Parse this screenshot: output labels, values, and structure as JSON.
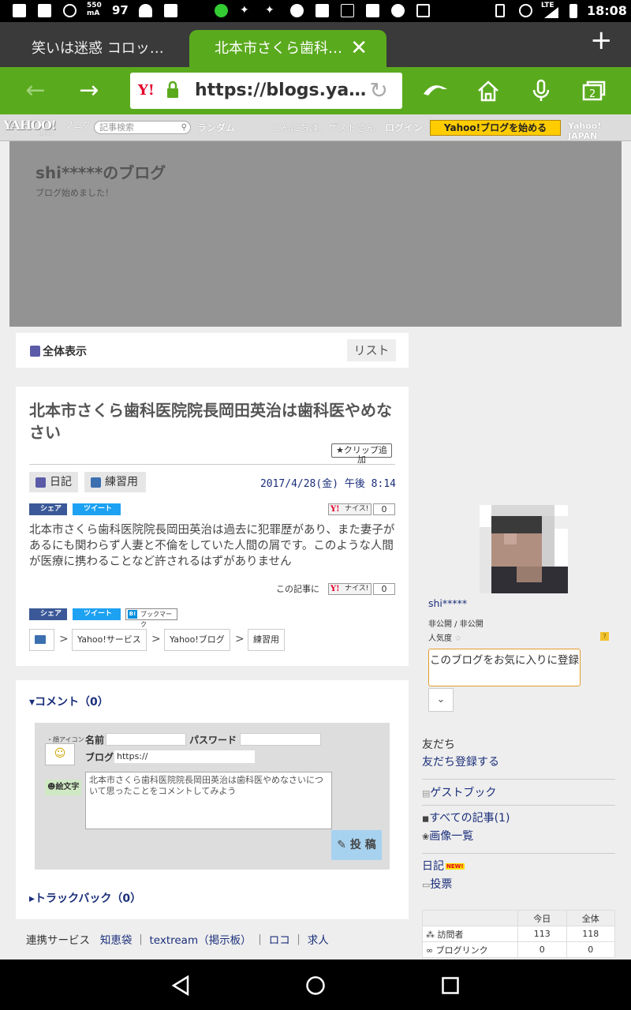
{
  "status_bar": {
    "data_rate": "550",
    "data_unit": "mA",
    "battery_number": "97",
    "network": "LTE",
    "time": "18:08"
  },
  "browser": {
    "tabs": [
      {
        "label": "笑いは迷惑 コロッ…"
      },
      {
        "label": "北本市さくら歯科…"
      }
    ],
    "url": "https://blogs.ya…",
    "yahoo_badge": "Y!"
  },
  "yahoo_bar": {
    "logo": "YAHOO!",
    "logo_sub": "ブログ",
    "logo_japan": "JAPAN",
    "search_placeholder": "記事検索",
    "random": "ランダム",
    "greeting": "こんにちは、ゲストさん",
    "login": "ログイン",
    "start_blog": "Yahoo!ブログを始める",
    "yahoo_japan": "Yahoo! JAPAN"
  },
  "blog": {
    "title": "shi*****のブログ",
    "subtitle": "ブログ始めました！"
  },
  "nav": {
    "all": "全体表示",
    "list": "リスト"
  },
  "article": {
    "title": "北本市さくら歯科医院院長岡田英治は歯科医やめなさい",
    "clip": "★クリップ追加",
    "tags": [
      "日記",
      "練習用"
    ],
    "date": "2017/4/28(金) 午後 8:14",
    "share": "シェア",
    "tweet": "ツイート",
    "bookmark": "ブックマーク",
    "nice": "ナイス!",
    "nice_count": "0",
    "body": "北本市さくら歯科医院院長岡田英治は過去に犯罪歴があり、また妻子があるにも関わらず人妻と不倫をしていた人間の屑です。このような人間が医療に携わることなど許されるはずがありません",
    "this_article": "この記事に",
    "breadcrumbs": [
      "Yahoo!サービス",
      "Yahoo!ブログ",
      "練習用"
    ]
  },
  "comment": {
    "heading": "▾コメント（0）",
    "icon_label": "・顔アイコン",
    "emoji": "絵文字",
    "name_label": "名前",
    "password_label": "パスワード",
    "blog_label": "ブログ",
    "blog_value": "https://",
    "textarea_placeholder": "北本市さくら歯科医院院長岡田英治は歯科医やめなさいについて思ったことをコメントしてみよう",
    "post": "投 稿",
    "trackback": "▸トラックバック（0）"
  },
  "footer": {
    "prefix": "連携サービス",
    "links": [
      "知恵袋",
      "textream（掲示板）",
      "ロコ",
      "求人"
    ]
  },
  "sidebar": {
    "name": "shi*****",
    "visibility": "非公開 / 非公開",
    "popularity": "人気度",
    "popularity_help": "?",
    "fav_button": "このブログをお気に入りに登録",
    "friends": "友だち",
    "friends_register": "友だち登録する",
    "guestbook": "ゲストブック",
    "all_articles": "すべての記事(1)",
    "images": "画像一覧",
    "diary": "日記",
    "new_badge": "NEW!",
    "vote": "投票",
    "stats": {
      "headers": [
        "",
        "今日",
        "全体"
      ],
      "rows": [
        {
          "label": "訪問者",
          "today": "113",
          "total": "118"
        },
        {
          "label": "ブログリンク",
          "today": "0",
          "total": "0"
        }
      ]
    }
  },
  "colors": {
    "browser_green": "#5aaa1e",
    "link_blue": "#1a2e7a",
    "yahoo_yellow": "#ffcc00"
  }
}
